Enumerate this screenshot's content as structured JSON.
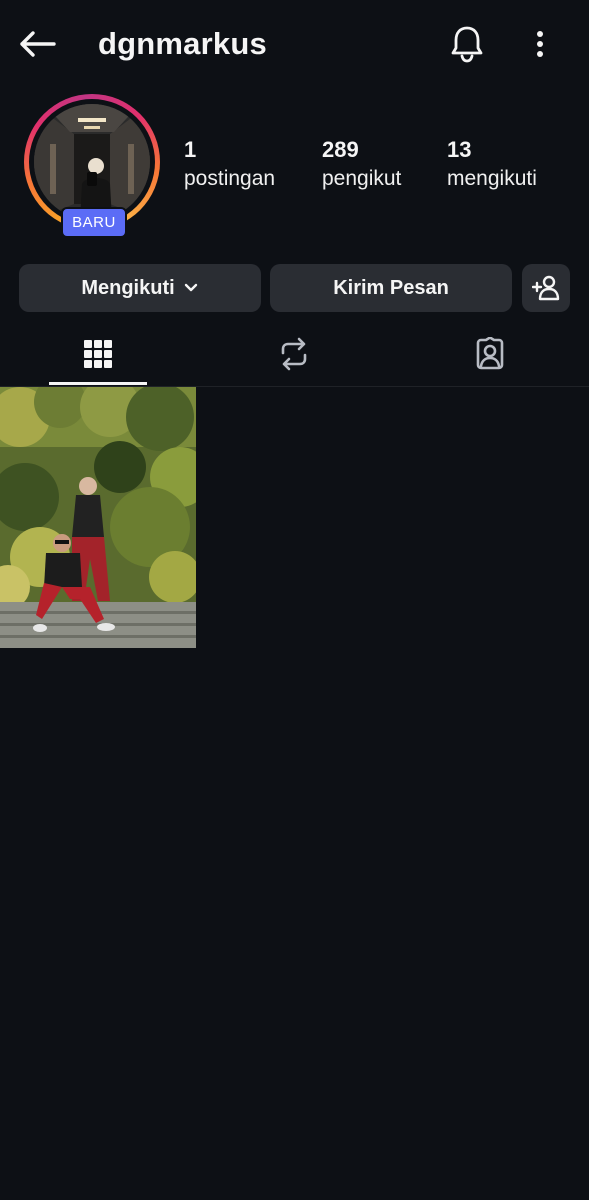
{
  "header": {
    "username": "dgnmarkus",
    "icons": {
      "back": "arrow-left-icon",
      "notifications": "bell-icon",
      "more": "more-vertical-icon"
    }
  },
  "profile": {
    "badge_label": "BARU",
    "stats": [
      {
        "value": "1",
        "label": "postingan"
      },
      {
        "value": "289",
        "label": "pengikut"
      },
      {
        "value": "13",
        "label": "mengikuti"
      }
    ]
  },
  "actions": {
    "following_label": "Mengikuti",
    "message_label": "Kirim Pesan",
    "add_person_icon": "person-add-icon"
  },
  "tabs": [
    {
      "icon": "grid-icon",
      "selected": true
    },
    {
      "icon": "repost-icon",
      "selected": false
    },
    {
      "icon": "tagged-person-icon",
      "selected": false
    }
  ],
  "theme": {
    "background": "#0d1015",
    "button": "#2a2d33",
    "badge": "#5b6cf6",
    "text": "#f5f5f5"
  }
}
